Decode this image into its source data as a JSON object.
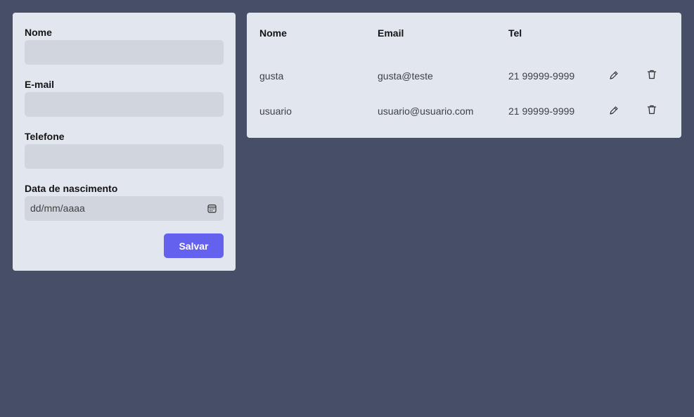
{
  "form": {
    "name_label": "Nome",
    "name_value": "",
    "email_label": "E-mail",
    "email_value": "",
    "phone_label": "Telefone",
    "phone_value": "",
    "birthdate_label": "Data de nascimento",
    "birthdate_placeholder": "dd/mm/aaaa",
    "save_label": "Salvar"
  },
  "table": {
    "headers": {
      "name": "Nome",
      "email": "Email",
      "phone": "Tel"
    },
    "rows": [
      {
        "name": "gusta",
        "email": "gusta@teste",
        "phone": "21 99999-9999",
        "edit_icon": "pencil-icon",
        "delete_icon": "trash-icon"
      },
      {
        "name": "usuario",
        "email": "usuario@usuario.com",
        "phone": "21 99999-9999",
        "edit_icon": "pencil-icon",
        "delete_icon": "trash-icon"
      }
    ]
  },
  "colors": {
    "background": "#474e68",
    "card": "#e1e6ef",
    "input": "#d1d5de",
    "accent": "#6461ee"
  }
}
